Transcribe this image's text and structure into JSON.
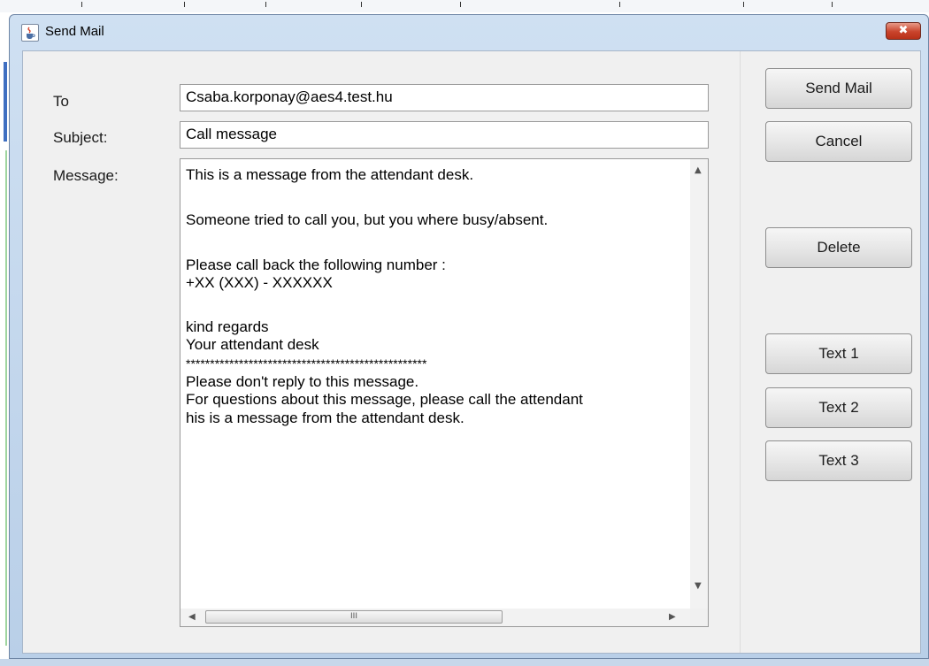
{
  "window": {
    "title": "Send Mail",
    "close_glyph": "✖"
  },
  "form": {
    "to_label": "To",
    "to_value": "Csaba.korponay@aes4.test.hu",
    "subject_label": "Subject:",
    "subject_value": "Call message",
    "message_label": "Message:",
    "message_lines": [
      "This is a message from the attendant desk.",
      "",
      "Someone tried to call you, but you where busy/absent.",
      "",
      "Please call back the following number :",
      "+XX (XXX) - XXXXXX",
      "",
      "kind regards",
      "Your attendant desk",
      "**************************************************",
      "Please don't reply to this message.",
      "For questions about this message, please call the attendant",
      "his is a message from the attendant desk."
    ]
  },
  "buttons": {
    "send_mail": "Send Mail",
    "cancel": "Cancel",
    "delete": "Delete",
    "text1": "Text 1",
    "text2": "Text 2",
    "text3": "Text 3"
  },
  "scroll": {
    "thumb_grip": "III",
    "up_arrow": "▲",
    "down_arrow": "▼",
    "left_arrow": "◀",
    "right_arrow": "▶"
  },
  "icons": {
    "app_icon": "java-cup-icon",
    "close": "close-icon"
  },
  "colors": {
    "title_bar": "#cfe0f2",
    "close_button": "#c9442c",
    "client_bg": "#f0f0f0"
  }
}
